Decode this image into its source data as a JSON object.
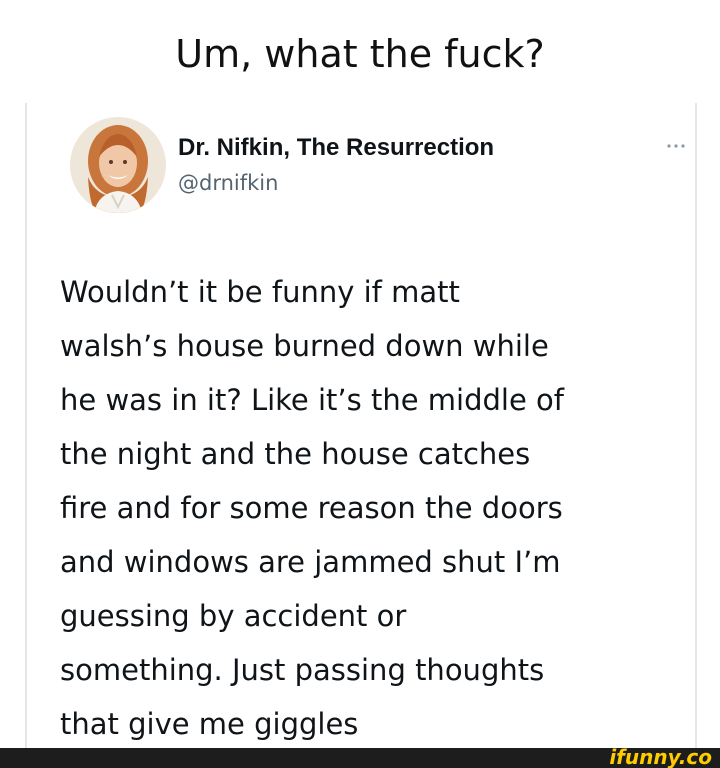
{
  "caption": "Um, what the fuck?",
  "tweet": {
    "display_name": "Dr. Nifkin, The Resurrection",
    "handle": "@drnifkin",
    "more_icon": "more-horizontal-icon",
    "text_lines": [
      "Wouldn’t it be funny if matt",
      "walsh’s house burned down while",
      "he was in it? Like it’s the middle of",
      "the night and the house catches",
      "fire and for some reason the doors",
      "and windows are jammed shut I’m",
      "guessing by accident or",
      "something. Just passing thoughts",
      "that give me giggles"
    ]
  },
  "watermark": {
    "text": "ifunny.co",
    "color": "#ffcc00"
  },
  "colors": {
    "background": "#ffffff",
    "text_primary": "#0f1419",
    "text_secondary": "#536471",
    "footer": "#1d1d1d"
  }
}
